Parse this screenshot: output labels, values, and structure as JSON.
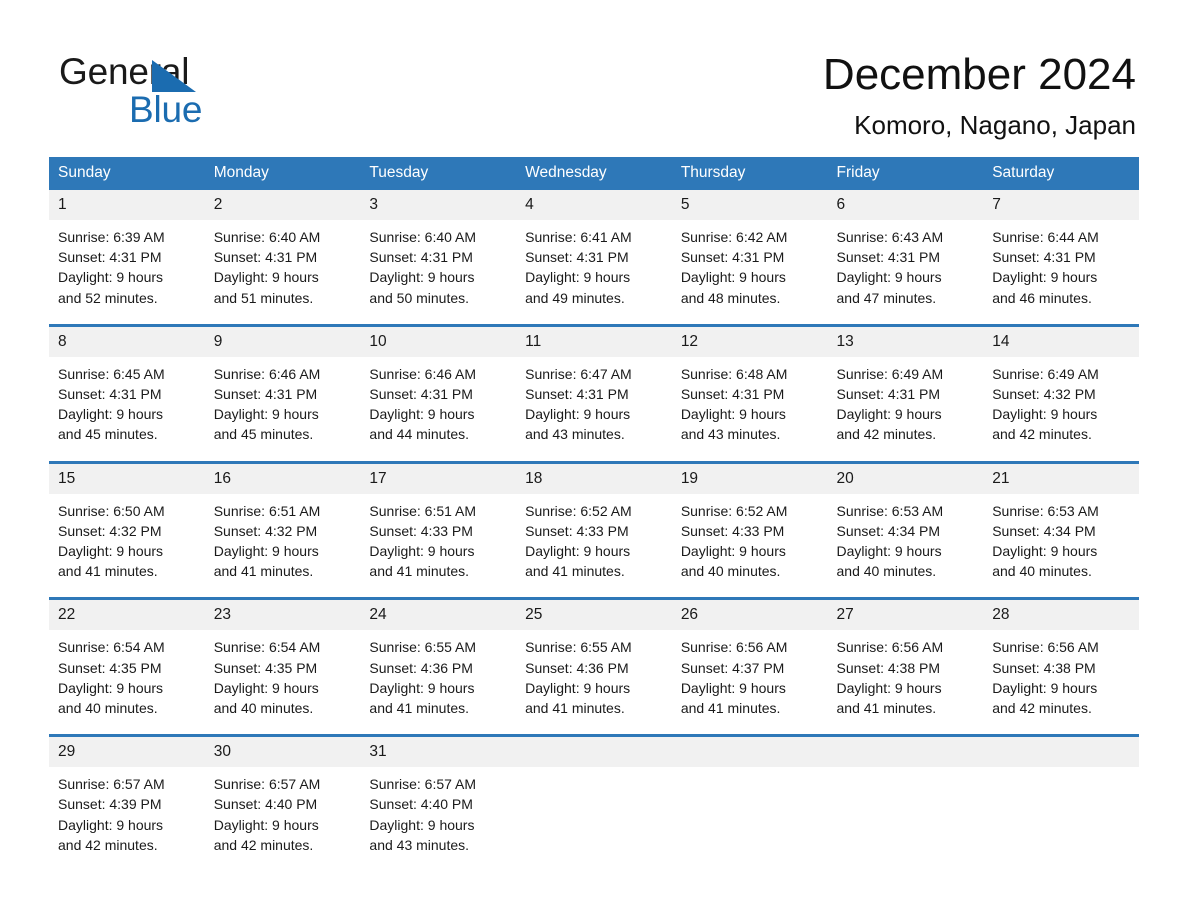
{
  "logo": {
    "text_primary": "General",
    "text_secondary": "Blue",
    "accent_color": "#1b6cb0"
  },
  "header": {
    "title": "December 2024",
    "subtitle": "Komoro, Nagano, Japan"
  },
  "theme": {
    "header_bg": "#2e78b8",
    "daynum_bg": "#f1f1f1",
    "text": "#1a1a1a",
    "page_bg": "#ffffff"
  },
  "calendar": {
    "weekday_headers": [
      "Sunday",
      "Monday",
      "Tuesday",
      "Wednesday",
      "Thursday",
      "Friday",
      "Saturday"
    ],
    "labels": {
      "sunrise_prefix": "Sunrise:",
      "sunset_prefix": "Sunset:",
      "daylight_prefix": "Daylight:"
    },
    "weeks": [
      [
        {
          "day": "1",
          "sunrise": "Sunrise: 6:39 AM",
          "sunset": "Sunset: 4:31 PM",
          "daylight_1": "Daylight: 9 hours",
          "daylight_2": "and 52 minutes."
        },
        {
          "day": "2",
          "sunrise": "Sunrise: 6:40 AM",
          "sunset": "Sunset: 4:31 PM",
          "daylight_1": "Daylight: 9 hours",
          "daylight_2": "and 51 minutes."
        },
        {
          "day": "3",
          "sunrise": "Sunrise: 6:40 AM",
          "sunset": "Sunset: 4:31 PM",
          "daylight_1": "Daylight: 9 hours",
          "daylight_2": "and 50 minutes."
        },
        {
          "day": "4",
          "sunrise": "Sunrise: 6:41 AM",
          "sunset": "Sunset: 4:31 PM",
          "daylight_1": "Daylight: 9 hours",
          "daylight_2": "and 49 minutes."
        },
        {
          "day": "5",
          "sunrise": "Sunrise: 6:42 AM",
          "sunset": "Sunset: 4:31 PM",
          "daylight_1": "Daylight: 9 hours",
          "daylight_2": "and 48 minutes."
        },
        {
          "day": "6",
          "sunrise": "Sunrise: 6:43 AM",
          "sunset": "Sunset: 4:31 PM",
          "daylight_1": "Daylight: 9 hours",
          "daylight_2": "and 47 minutes."
        },
        {
          "day": "7",
          "sunrise": "Sunrise: 6:44 AM",
          "sunset": "Sunset: 4:31 PM",
          "daylight_1": "Daylight: 9 hours",
          "daylight_2": "and 46 minutes."
        }
      ],
      [
        {
          "day": "8",
          "sunrise": "Sunrise: 6:45 AM",
          "sunset": "Sunset: 4:31 PM",
          "daylight_1": "Daylight: 9 hours",
          "daylight_2": "and 45 minutes."
        },
        {
          "day": "9",
          "sunrise": "Sunrise: 6:46 AM",
          "sunset": "Sunset: 4:31 PM",
          "daylight_1": "Daylight: 9 hours",
          "daylight_2": "and 45 minutes."
        },
        {
          "day": "10",
          "sunrise": "Sunrise: 6:46 AM",
          "sunset": "Sunset: 4:31 PM",
          "daylight_1": "Daylight: 9 hours",
          "daylight_2": "and 44 minutes."
        },
        {
          "day": "11",
          "sunrise": "Sunrise: 6:47 AM",
          "sunset": "Sunset: 4:31 PM",
          "daylight_1": "Daylight: 9 hours",
          "daylight_2": "and 43 minutes."
        },
        {
          "day": "12",
          "sunrise": "Sunrise: 6:48 AM",
          "sunset": "Sunset: 4:31 PM",
          "daylight_1": "Daylight: 9 hours",
          "daylight_2": "and 43 minutes."
        },
        {
          "day": "13",
          "sunrise": "Sunrise: 6:49 AM",
          "sunset": "Sunset: 4:31 PM",
          "daylight_1": "Daylight: 9 hours",
          "daylight_2": "and 42 minutes."
        },
        {
          "day": "14",
          "sunrise": "Sunrise: 6:49 AM",
          "sunset": "Sunset: 4:32 PM",
          "daylight_1": "Daylight: 9 hours",
          "daylight_2": "and 42 minutes."
        }
      ],
      [
        {
          "day": "15",
          "sunrise": "Sunrise: 6:50 AM",
          "sunset": "Sunset: 4:32 PM",
          "daylight_1": "Daylight: 9 hours",
          "daylight_2": "and 41 minutes."
        },
        {
          "day": "16",
          "sunrise": "Sunrise: 6:51 AM",
          "sunset": "Sunset: 4:32 PM",
          "daylight_1": "Daylight: 9 hours",
          "daylight_2": "and 41 minutes."
        },
        {
          "day": "17",
          "sunrise": "Sunrise: 6:51 AM",
          "sunset": "Sunset: 4:33 PM",
          "daylight_1": "Daylight: 9 hours",
          "daylight_2": "and 41 minutes."
        },
        {
          "day": "18",
          "sunrise": "Sunrise: 6:52 AM",
          "sunset": "Sunset: 4:33 PM",
          "daylight_1": "Daylight: 9 hours",
          "daylight_2": "and 41 minutes."
        },
        {
          "day": "19",
          "sunrise": "Sunrise: 6:52 AM",
          "sunset": "Sunset: 4:33 PM",
          "daylight_1": "Daylight: 9 hours",
          "daylight_2": "and 40 minutes."
        },
        {
          "day": "20",
          "sunrise": "Sunrise: 6:53 AM",
          "sunset": "Sunset: 4:34 PM",
          "daylight_1": "Daylight: 9 hours",
          "daylight_2": "and 40 minutes."
        },
        {
          "day": "21",
          "sunrise": "Sunrise: 6:53 AM",
          "sunset": "Sunset: 4:34 PM",
          "daylight_1": "Daylight: 9 hours",
          "daylight_2": "and 40 minutes."
        }
      ],
      [
        {
          "day": "22",
          "sunrise": "Sunrise: 6:54 AM",
          "sunset": "Sunset: 4:35 PM",
          "daylight_1": "Daylight: 9 hours",
          "daylight_2": "and 40 minutes."
        },
        {
          "day": "23",
          "sunrise": "Sunrise: 6:54 AM",
          "sunset": "Sunset: 4:35 PM",
          "daylight_1": "Daylight: 9 hours",
          "daylight_2": "and 40 minutes."
        },
        {
          "day": "24",
          "sunrise": "Sunrise: 6:55 AM",
          "sunset": "Sunset: 4:36 PM",
          "daylight_1": "Daylight: 9 hours",
          "daylight_2": "and 41 minutes."
        },
        {
          "day": "25",
          "sunrise": "Sunrise: 6:55 AM",
          "sunset": "Sunset: 4:36 PM",
          "daylight_1": "Daylight: 9 hours",
          "daylight_2": "and 41 minutes."
        },
        {
          "day": "26",
          "sunrise": "Sunrise: 6:56 AM",
          "sunset": "Sunset: 4:37 PM",
          "daylight_1": "Daylight: 9 hours",
          "daylight_2": "and 41 minutes."
        },
        {
          "day": "27",
          "sunrise": "Sunrise: 6:56 AM",
          "sunset": "Sunset: 4:38 PM",
          "daylight_1": "Daylight: 9 hours",
          "daylight_2": "and 41 minutes."
        },
        {
          "day": "28",
          "sunrise": "Sunrise: 6:56 AM",
          "sunset": "Sunset: 4:38 PM",
          "daylight_1": "Daylight: 9 hours",
          "daylight_2": "and 42 minutes."
        }
      ],
      [
        {
          "day": "29",
          "sunrise": "Sunrise: 6:57 AM",
          "sunset": "Sunset: 4:39 PM",
          "daylight_1": "Daylight: 9 hours",
          "daylight_2": "and 42 minutes."
        },
        {
          "day": "30",
          "sunrise": "Sunrise: 6:57 AM",
          "sunset": "Sunset: 4:40 PM",
          "daylight_1": "Daylight: 9 hours",
          "daylight_2": "and 42 minutes."
        },
        {
          "day": "31",
          "sunrise": "Sunrise: 6:57 AM",
          "sunset": "Sunset: 4:40 PM",
          "daylight_1": "Daylight: 9 hours",
          "daylight_2": "and 43 minutes."
        },
        {
          "day": "",
          "sunrise": "",
          "sunset": "",
          "daylight_1": "",
          "daylight_2": ""
        },
        {
          "day": "",
          "sunrise": "",
          "sunset": "",
          "daylight_1": "",
          "daylight_2": ""
        },
        {
          "day": "",
          "sunrise": "",
          "sunset": "",
          "daylight_1": "",
          "daylight_2": ""
        },
        {
          "day": "",
          "sunrise": "",
          "sunset": "",
          "daylight_1": "",
          "daylight_2": ""
        }
      ]
    ]
  }
}
